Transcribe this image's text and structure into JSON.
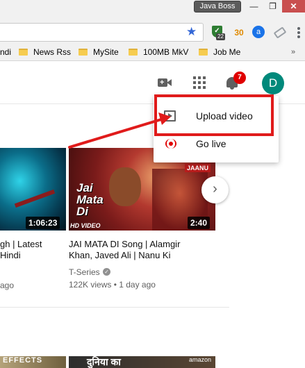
{
  "browser": {
    "profile_name": "Java Boss",
    "window_controls": {
      "minimize": "—",
      "maximize": "❐",
      "close": "✕"
    },
    "star_icon": "★",
    "extensions": {
      "shield_badge": "22",
      "sun_label": "30",
      "a_label": "a"
    },
    "bookmarks": [
      "ndi",
      "News Rss",
      "MySite",
      "100MB MkV",
      "Job Me"
    ]
  },
  "header": {
    "notification_count": "7",
    "avatar_letter": "D",
    "icons": [
      "create-video-icon",
      "apps-grid-icon",
      "notifications-bell-icon"
    ]
  },
  "create_menu": {
    "items": [
      {
        "label": "Upload video",
        "icon": "upload-video-icon"
      },
      {
        "label": "Go live",
        "icon": "go-live-icon"
      }
    ]
  },
  "videos": [
    {
      "title_line1": "gh | Latest",
      "title_line2": "Hindi",
      "meta": "ago",
      "duration": "1:06:23"
    },
    {
      "title_line1": "JAI MATA DI Song | Alamgir",
      "title_line2": "Khan, Javed Ali | Nanu Ki",
      "channel": "T-Series",
      "meta": "122K views • 1 day ago",
      "duration": "2:40",
      "thumb_art_text": "Jai Mata Di",
      "thumb_brand": "JAANU",
      "hd_badge": "HD VIDEO"
    }
  ],
  "next_row": {
    "thumb1_text": "EFFECTS",
    "thumb2_text": "दुनिया का",
    "thumb2_brand": "amazon"
  },
  "next_arrow": "›",
  "colors": {
    "annotation": "#e01b1b",
    "notification_badge": "#e00000",
    "avatar": "#00897b",
    "star": "#3367d6"
  }
}
